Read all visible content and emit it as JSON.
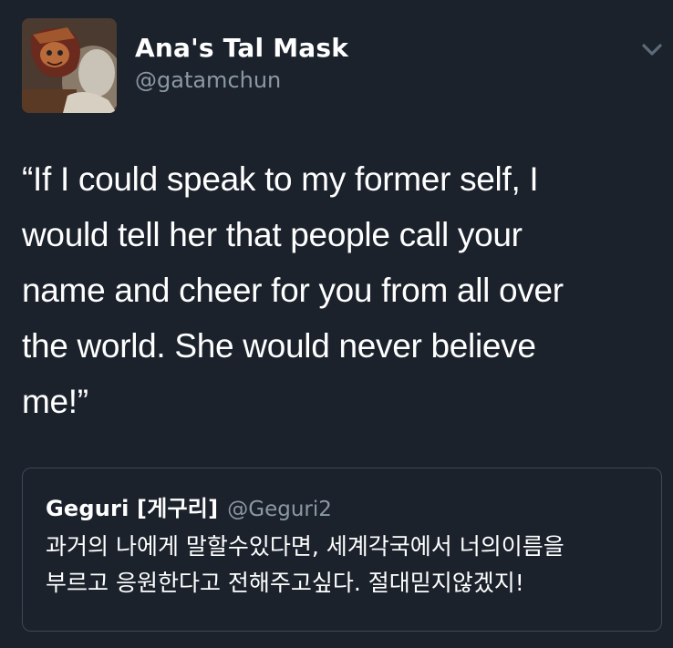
{
  "tweet": {
    "author": {
      "display_name": "Ana's Tal Mask",
      "handle": "@gatamchun",
      "avatar_icon": "profile-avatar-image"
    },
    "menu_icon": "chevron-down-icon",
    "text": "“If I could speak to my former self, I\nwould tell her that people call your\nname and cheer for you from all over\nthe world. She would never believe\nme!”"
  },
  "quoted_tweet": {
    "display_name": "Geguri  [게구리]",
    "handle": "@Geguri2",
    "text": "과거의 나에게 말할수있다면, 세계각국에서 너의이름을\n부르고 응원한다고 전해주고싶다. 절대믿지않겠지!"
  },
  "colors": {
    "background": "#1b222c",
    "primary_text": "#ffffff",
    "secondary_text": "#8b98a5",
    "quote_border": "#3d4957"
  }
}
